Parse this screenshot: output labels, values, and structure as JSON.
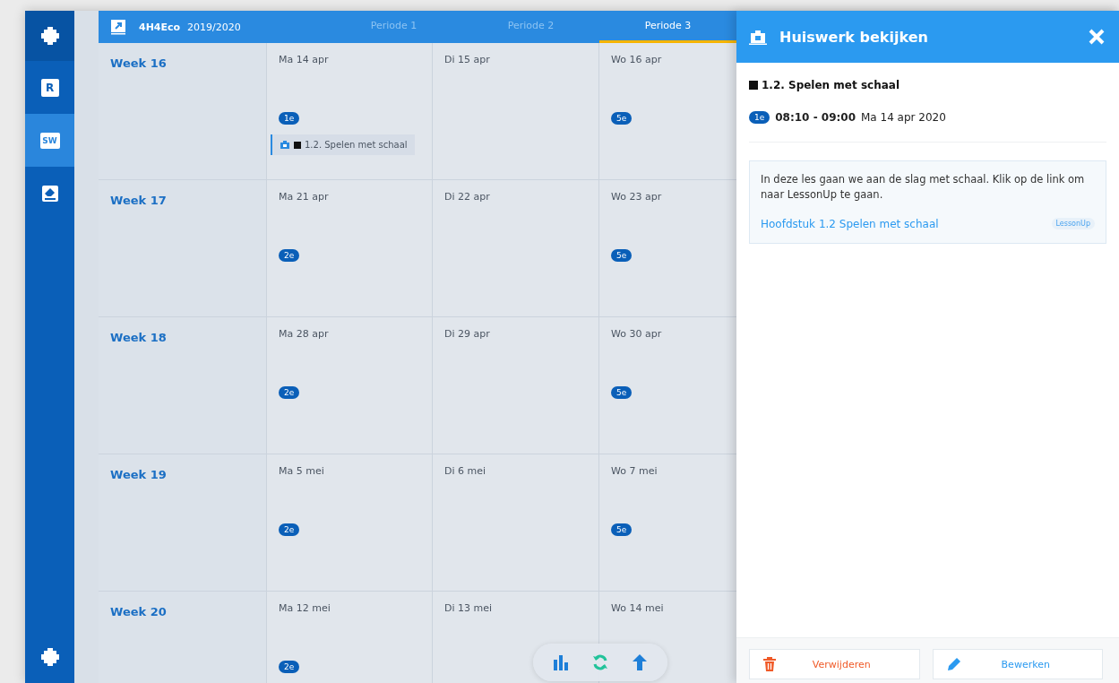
{
  "sidebar": {
    "items": [
      {
        "kind": "gear",
        "selected": false
      },
      {
        "kind": "calendar",
        "label": "R",
        "selected": false
      },
      {
        "kind": "sw",
        "label": "SW",
        "selected": true
      },
      {
        "kind": "eraser",
        "selected": false
      }
    ]
  },
  "header": {
    "class_label": "4H4Eco",
    "year": "2019/2020",
    "tabs": [
      {
        "label": "Periode 1",
        "selected": false
      },
      {
        "label": "Periode 2",
        "selected": false
      },
      {
        "label": "Periode 3",
        "selected": true
      }
    ]
  },
  "weeks": [
    {
      "label": "Week 16",
      "days": [
        {
          "label": "Ma 14 apr",
          "badge": "1e",
          "items": [
            {
              "title": "1.2. Spelen met schaal"
            }
          ]
        },
        {
          "label": "Di 15 apr"
        },
        {
          "label": "Wo 16 apr",
          "badge": "5e"
        }
      ]
    },
    {
      "label": "Week 17",
      "days": [
        {
          "label": "Ma 21 apr",
          "badge": "2e"
        },
        {
          "label": "Di 22 apr"
        },
        {
          "label": "Wo 23 apr",
          "badge": "5e"
        }
      ]
    },
    {
      "label": "Week 18",
      "days": [
        {
          "label": "Ma 28 apr",
          "badge": "2e"
        },
        {
          "label": "Di 29 apr"
        },
        {
          "label": "Wo 30 apr",
          "badge": "5e"
        }
      ]
    },
    {
      "label": "Week 19",
      "days": [
        {
          "label": "Ma 5 mei",
          "badge": "2e"
        },
        {
          "label": "Di 6 mei"
        },
        {
          "label": "Wo 7 mei",
          "badge": "5e"
        }
      ]
    },
    {
      "label": "Week 20",
      "days": [
        {
          "label": "Ma 12 mei",
          "badge": "2e"
        },
        {
          "label": "Di 13 mei"
        },
        {
          "label": "Wo 14 mei"
        }
      ]
    }
  ],
  "panel": {
    "title": "Huiswerk bekijken",
    "item_title": "1.2. Spelen met schaal",
    "badge": "1e",
    "time": "08:10 - 09:00",
    "date": "Ma 14 apr 2020",
    "description": "In deze les gaan we aan de slag met schaal. Klik op de link om naar LessonUp te gaan.",
    "link": "Hoofdstuk 1.2 Spelen met schaal",
    "link_tag": "LessonUp",
    "buttons": [
      {
        "kind": "delete",
        "label": "Verwijderen"
      },
      {
        "kind": "edit",
        "label": "Bewerken"
      }
    ]
  }
}
